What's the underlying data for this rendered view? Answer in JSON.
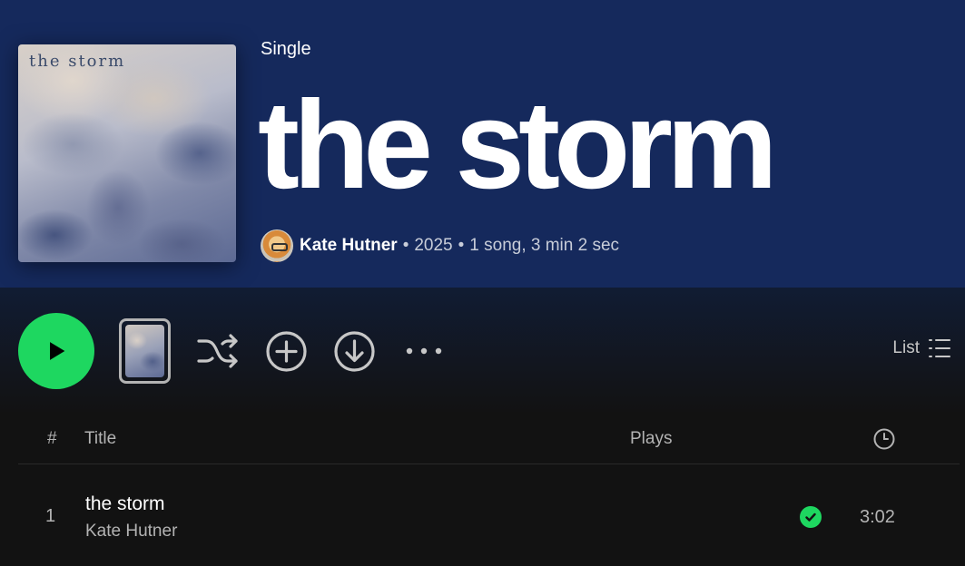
{
  "header": {
    "type_label": "Single",
    "title": "the storm",
    "cover_text": "the storm",
    "artist": "Kate Hutner",
    "year": "2025",
    "summary": "1 song, 3 min 2 sec",
    "bg_color": "#15295c"
  },
  "controls": {
    "play_icon": "play-icon",
    "shuffle_icon": "shuffle-icon",
    "add_icon": "add-circle-icon",
    "download_icon": "download-circle-icon",
    "more_icon": "more-horizontal-icon",
    "view_label": "List",
    "accent_color": "#1ed760"
  },
  "table": {
    "col_num": "#",
    "col_title": "Title",
    "col_plays": "Plays",
    "col_duration_icon": "clock-icon"
  },
  "tracks": [
    {
      "num": "1",
      "title": "the storm",
      "artist": "Kate Hutner",
      "duration": "3:02",
      "saved_icon": "check-circle-icon"
    }
  ]
}
